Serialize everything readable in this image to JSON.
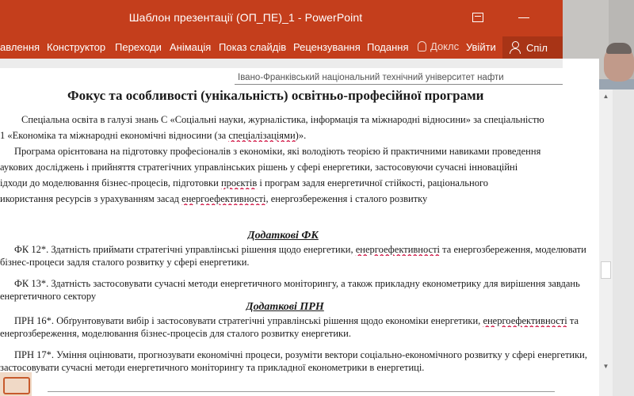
{
  "window": {
    "title": "Шаблон презентації (ОП_ПЕ)_1 - PowerPoint"
  },
  "ribbon": {
    "tabs": [
      "авлення",
      "Конструктор",
      "Переходи",
      "Анімація",
      "Показ слайдів",
      "Рецензування",
      "Подання"
    ],
    "tell_me": "Доклс",
    "sign_in": "Увійти",
    "share": "Спіл"
  },
  "document": {
    "header": "Івано-Франківський національний технічний університет нафти",
    "title": "Фокус та особливості (унікальність) освітньо-професійної програми",
    "para1": [
      "Спеціальна освіта в галузі знань С «Соціальні науки, журналістика, інформація та міжнародні відносини» за спеціальністю",
      "1 «Економіка та міжнародні економічні відносини (за ",
      "спеціалізаціями",
      ")»."
    ],
    "para2": [
      "Програма орієнтована на підготовку професіоналів з економіки, які володіють теорією й практичними навиками проведення",
      "аукових досліджень і прийняття стратегічних управлінських рішень у сфері енергетики, застосовуючи сучасні інноваційні",
      "ідходи до моделювання бізнес-процесів, підготовки ",
      "проєктів",
      " і програм задля енергетичної стійкості, раціонального",
      "икористання ресурсів з урахуванням засад ",
      "енергоефективності",
      ", енергозбереження і сталого розвитку"
    ],
    "fk_head": "Додаткові ФК",
    "fk12": [
      "ФК 12*. Здатність приймати стратегічні управлінські рішення щодо енергетики, ",
      "енергоефективності",
      " та енергозбереження, моделювати",
      "бізнес-процеси задля сталого розвитку у сфері енергетики."
    ],
    "fk13": [
      "ФК 13*. Здатність застосовувати сучасні методи енергетичного моніторингу, а також прикладну економетрику для вирішення завдань",
      "енергетичного сектору"
    ],
    "prn_head": "Додаткові ПРН",
    "prn16": [
      "ПРН 16*. Обґрунтовувати вибір і застосовувати стратегічні управлінські рішення щодо економіки енергетики, ",
      "енергоефективності",
      " та",
      "енергозбереження, моделювання бізнес-процесів для сталого розвитку енергетики."
    ],
    "prn17": [
      "ПРН 17*. Уміння оцінювати, прогнозувати економічні процеси, розуміти вектори соціально-економічного розвитку у сфері енергетики,",
      "застосовувати сучасні методи енергетичного моніторингу та прикладної економетрики в енергетиці."
    ]
  },
  "colors": {
    "ribbon": "#c43e1c",
    "share_bg": "#a83416"
  }
}
